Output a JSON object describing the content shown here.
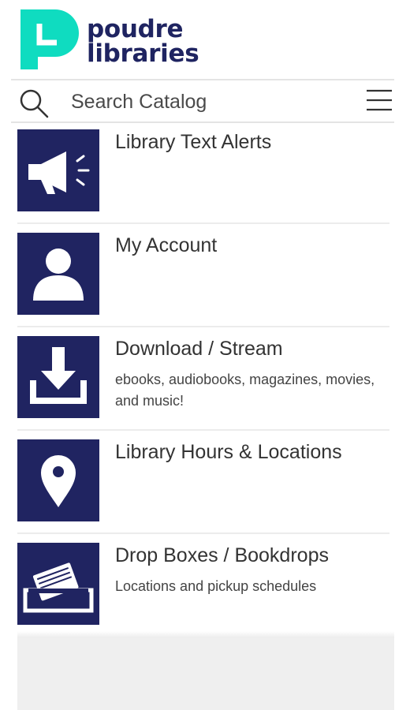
{
  "brand": {
    "name_line1": "poudre",
    "name_line2": "libraries",
    "primary_color": "#1f2461",
    "accent_color": "#0fdcc0"
  },
  "search": {
    "placeholder": "Search Catalog",
    "value": ""
  },
  "menu": {
    "icon": "hamburger-menu-icon"
  },
  "items": [
    {
      "title": "Library Text Alerts",
      "subtitle": "",
      "icon": "megaphone-icon"
    },
    {
      "title": "My Account",
      "subtitle": "",
      "icon": "person-icon"
    },
    {
      "title": "Download / Stream",
      "subtitle": "ebooks, audiobooks, magazines, movies, and music!",
      "icon": "download-icon"
    },
    {
      "title": "Library Hours & Locations",
      "subtitle": "",
      "icon": "map-pin-icon"
    },
    {
      "title": "Drop Boxes / Bookdrops",
      "subtitle": "Locations and pickup schedules",
      "icon": "book-drop-icon"
    }
  ]
}
